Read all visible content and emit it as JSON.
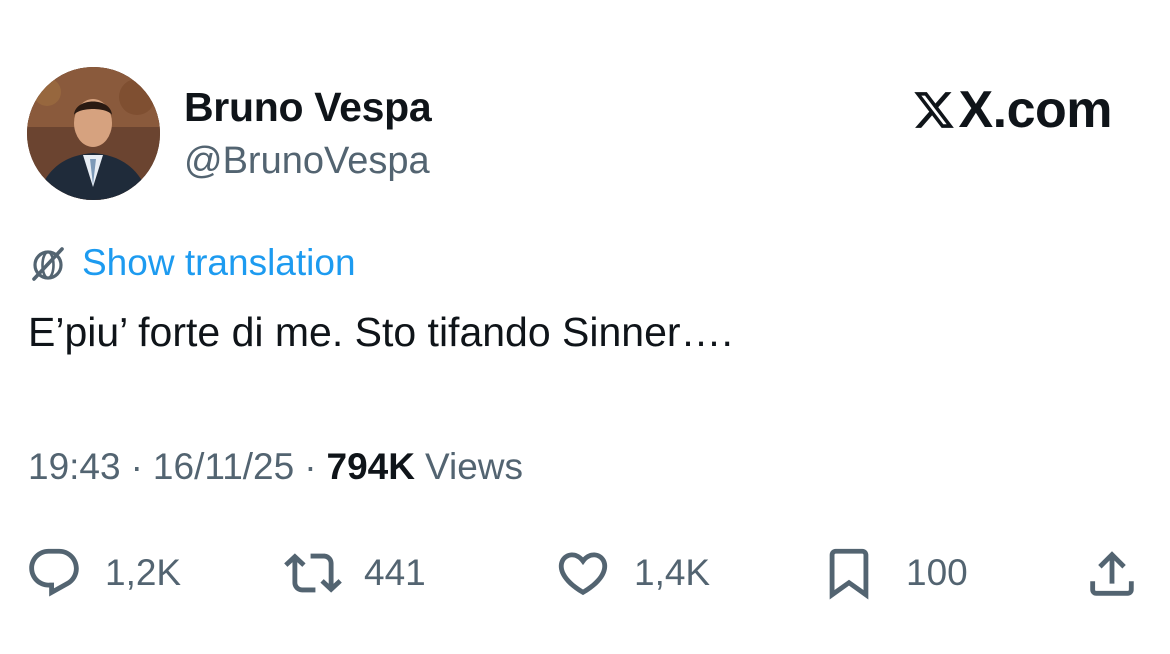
{
  "author": {
    "display_name": "Bruno Vespa",
    "handle": "@BrunoVespa",
    "avatar_icon": "profile-photo"
  },
  "brand": {
    "text": "X.com",
    "icon": "x-logo-icon"
  },
  "translation": {
    "label": "Show translation",
    "icon": "globe-strike-icon"
  },
  "tweet": {
    "text": "E’piu’ forte di me. Sto tifando Sinner…."
  },
  "meta": {
    "time": "19:43",
    "date": "16/11/25",
    "separator": "·",
    "views_count": "794K",
    "views_label": "Views"
  },
  "actions": {
    "reply": {
      "icon": "reply-icon",
      "count": "1,2K"
    },
    "retweet": {
      "icon": "retweet-icon",
      "count": "441"
    },
    "like": {
      "icon": "heart-icon",
      "count": "1,4K"
    },
    "bookmark": {
      "icon": "bookmark-icon",
      "count": "100"
    },
    "share": {
      "icon": "share-icon"
    }
  },
  "colors": {
    "text": "#0f1419",
    "secondary": "#536471",
    "link": "#1d9bf0",
    "background": "#ffffff"
  }
}
